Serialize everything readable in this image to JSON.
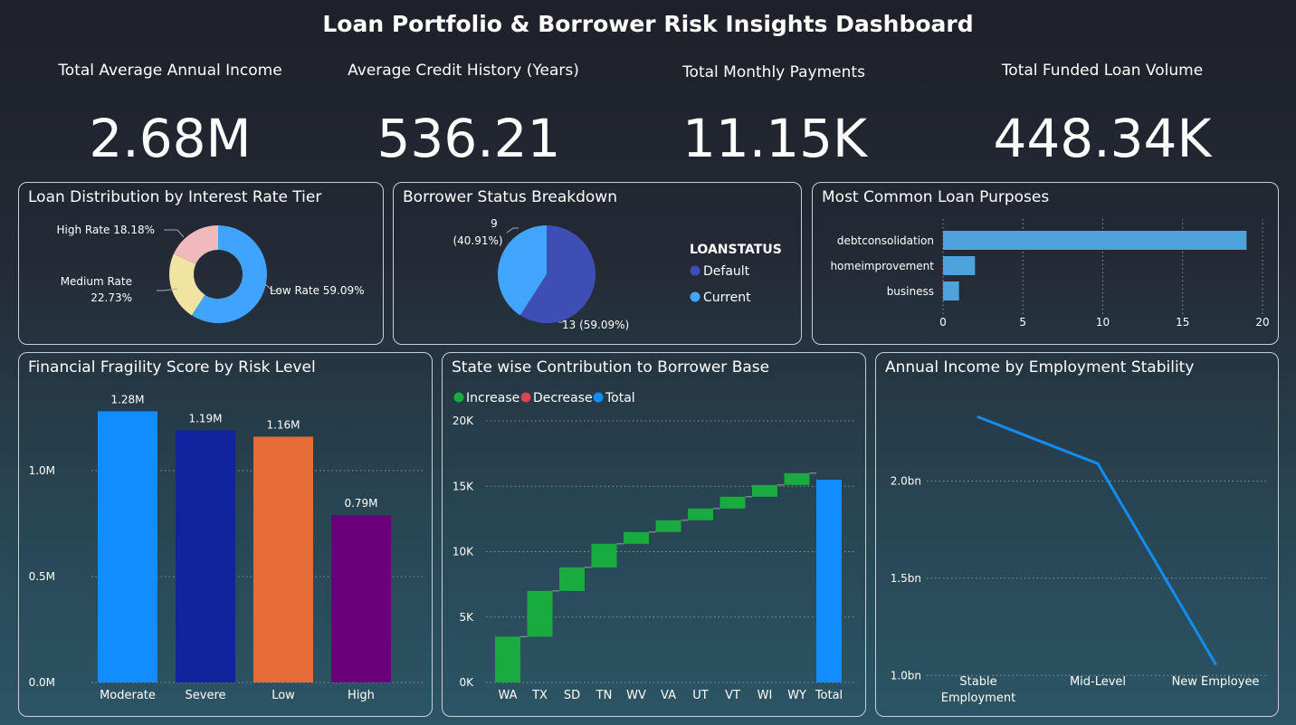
{
  "page": {
    "title": "Loan Portfolio & Borrower Risk Insights Dashboard"
  },
  "kpis": [
    {
      "label": "Total Average Annual Income",
      "value": "2.68M"
    },
    {
      "label": "Average Credit History (Years)",
      "value": "536.21"
    },
    {
      "label": "Total Monthly Payments",
      "value": "11.15K"
    },
    {
      "label": "Total Funded Loan Volume",
      "value": "448.34K"
    }
  ],
  "panels": {
    "donut": {
      "title": "Loan Distribution by Interest Rate Tier"
    },
    "pie": {
      "title": "Borrower Status Breakdown"
    },
    "purpose": {
      "title": "Most Common Loan Purposes"
    },
    "fragility": {
      "title": "Financial Fragility Score by Risk Level"
    },
    "waterfall": {
      "title": "State wise Contribution to Borrower Base"
    },
    "income": {
      "title": "Annual Income by Employment Stability"
    }
  },
  "chart_data": [
    {
      "type": "pie",
      "variant": "donut",
      "categories": [
        "Low Rate",
        "Medium Rate",
        "High Rate"
      ],
      "values": [
        59.09,
        22.73,
        18.18
      ],
      "labels": [
        "Low Rate 59.09%",
        "Medium Rate",
        "22.73%",
        "High Rate 18.18%"
      ],
      "colors": [
        "#40a4ff",
        "#f1e3a2",
        "#f0b9bc"
      ]
    },
    {
      "type": "pie",
      "legend_title": "LOANSTATUS",
      "categories": [
        "Default",
        "Current"
      ],
      "values": [
        13,
        9
      ],
      "labels": [
        "13 (59.09%)",
        "9",
        "(40.91%)"
      ],
      "colors": [
        "#3f4eb5",
        "#41a4fd"
      ],
      "legend": "right"
    },
    {
      "type": "bar",
      "orientation": "horizontal",
      "categories": [
        "debtconsolidation",
        "homeimprovement",
        "business"
      ],
      "values": [
        19,
        2,
        1
      ],
      "xlim": [
        0,
        20
      ],
      "xticks": [
        "0",
        "5",
        "10",
        "15",
        "20"
      ],
      "color": "#4fa3dd",
      "grid": true
    },
    {
      "type": "bar",
      "categories": [
        "Moderate",
        "Severe",
        "Low",
        "High"
      ],
      "values": [
        1.28,
        1.19,
        1.16,
        0.79
      ],
      "data_labels": [
        "1.28M",
        "1.19M",
        "1.16M",
        "0.79M"
      ],
      "ylim": [
        0,
        1.35
      ],
      "yticks": [
        {
          "v": 0,
          "t": "0.0M"
        },
        {
          "v": 0.5,
          "t": "0.5M"
        },
        {
          "v": 1.0,
          "t": "1.0M"
        }
      ],
      "colors": [
        "#118dff",
        "#12239e",
        "#e66c37",
        "#6b007b"
      ],
      "grid": true
    },
    {
      "type": "waterfall",
      "legend": [
        "Increase",
        "Decrease",
        "Total"
      ],
      "legend_colors": [
        "#1aab40",
        "#d64550",
        "#118dff"
      ],
      "categories": [
        "WA",
        "TX",
        "SD",
        "TN",
        "WV",
        "VA",
        "UT",
        "VT",
        "WI",
        "WY"
      ],
      "total_label": "Total",
      "values": [
        3500,
        3500,
        1800,
        1800,
        900,
        900,
        900,
        900,
        900,
        900
      ],
      "total": 15500,
      "ylim": [
        0,
        20000
      ],
      "yticks": [
        {
          "v": 0,
          "t": "0K"
        },
        {
          "v": 5000,
          "t": "5K"
        },
        {
          "v": 10000,
          "t": "10K"
        },
        {
          "v": 15000,
          "t": "15K"
        },
        {
          "v": 20000,
          "t": "20K"
        }
      ],
      "grid": true
    },
    {
      "type": "line",
      "categories": [
        [
          "Stable",
          "Employment"
        ],
        [
          "Mid-Level"
        ],
        [
          "New Employee"
        ]
      ],
      "values": [
        2.33,
        2.09,
        1.06
      ],
      "ylim": [
        0.95,
        2.45
      ],
      "yticks": [
        {
          "v": 1.0,
          "t": "1.0bn"
        },
        {
          "v": 1.5,
          "t": "1.5bn"
        },
        {
          "v": 2.0,
          "t": "2.0bn"
        }
      ],
      "color": "#118dff",
      "grid": true
    }
  ]
}
